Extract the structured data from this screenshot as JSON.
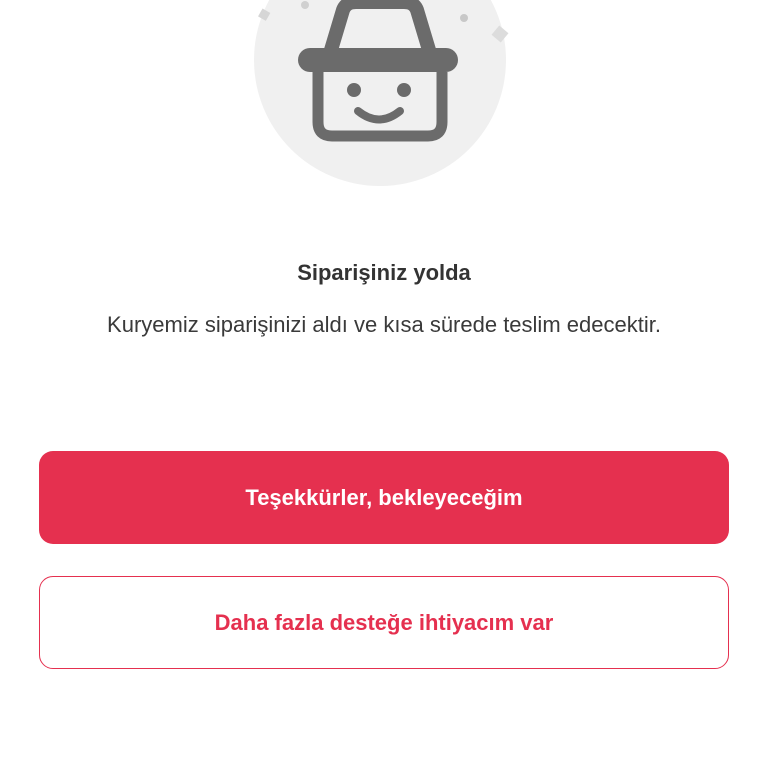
{
  "illustration": {
    "icon": "smiling-basket-icon"
  },
  "status": {
    "title": "Siparişiniz yolda",
    "message": "Kuryemiz siparişinizi aldı ve kısa sürede teslim edecektir."
  },
  "actions": {
    "confirm_label": "Teşekkürler, bekleyeceğim",
    "support_label": "Daha fazla desteğe ihtiyacım var"
  },
  "colors": {
    "accent": "#e5304f",
    "illustration_bg": "#f0f0f0",
    "icon_gray": "#6b6b6b"
  }
}
